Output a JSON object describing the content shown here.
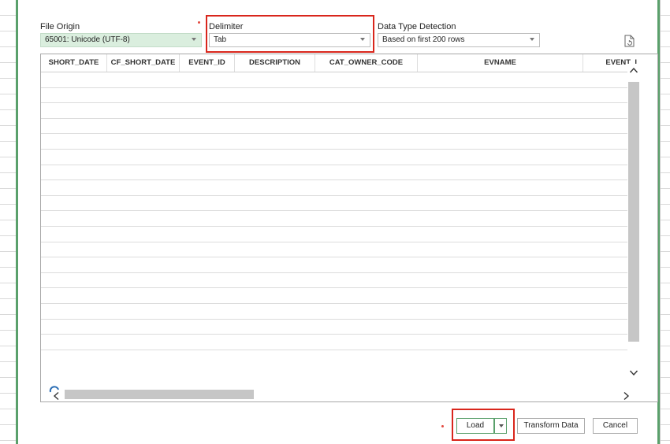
{
  "file_origin": {
    "label": "File Origin",
    "value": "65001: Unicode (UTF-8)"
  },
  "delimiter": {
    "label": "Delimiter",
    "value": "Tab"
  },
  "data_type_detection": {
    "label": "Data Type Detection",
    "value": "Based on first 200 rows"
  },
  "table": {
    "columns": [
      "SHORT_DATE",
      "CF_SHORT_DATE",
      "EVENT_ID",
      "DESCRIPTION",
      "CAT_OWNER_CODE",
      "EVNAME",
      "EVENT_I"
    ],
    "row_count": 18
  },
  "footer": {
    "load_label": "Load",
    "transform_label": "Transform Data",
    "cancel_label": "Cancel"
  },
  "colors": {
    "highlight": "#d9261c",
    "accent_green": "#5aa06b",
    "file_origin_bg": "#daeede"
  },
  "icons": {
    "refresh": "refresh-document-icon",
    "loading": "loading-spinner-icon",
    "dropdown": "chevron-down-icon"
  }
}
